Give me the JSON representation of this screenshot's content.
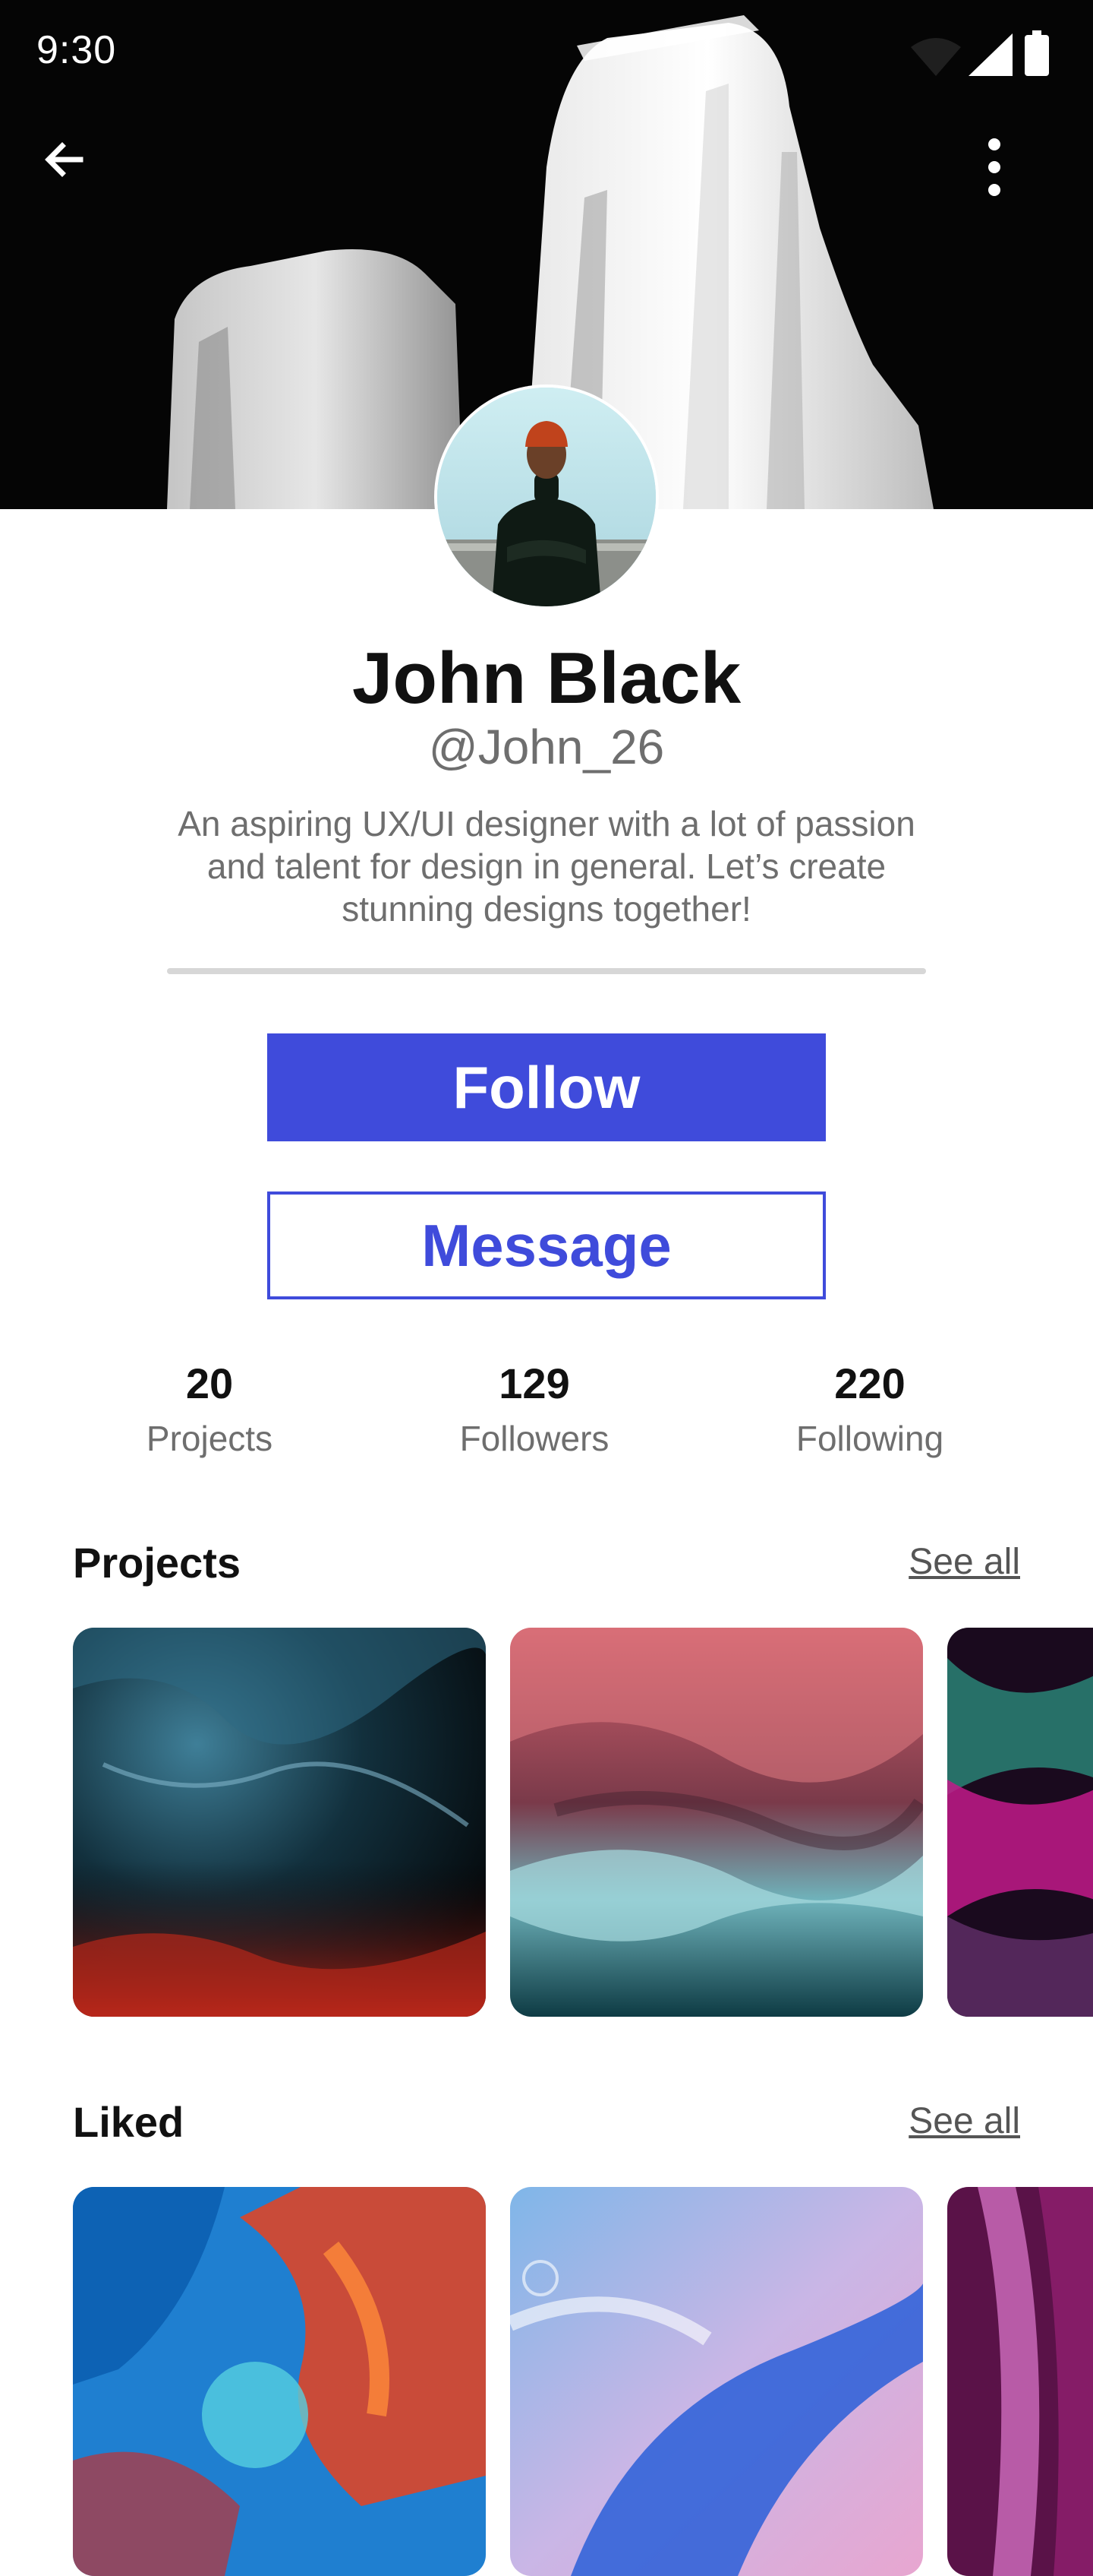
{
  "status_bar": {
    "time": "9:30"
  },
  "toolbar": {
    "back_icon": "arrow-left-icon",
    "more_icon": "more-vertical-icon"
  },
  "profile": {
    "name": "John Black",
    "handle": "@John_26",
    "bio": "An aspiring UX/UI designer with a lot of passion and talent for design in general. Let’s create stunning designs together!"
  },
  "actions": {
    "follow_label": "Follow",
    "message_label": "Message"
  },
  "stats": [
    {
      "value": "20",
      "label": "Projects"
    },
    {
      "value": "129",
      "label": "Followers"
    },
    {
      "value": "220",
      "label": "Following"
    }
  ],
  "sections": {
    "projects": {
      "title": "Projects",
      "see_all": "See all"
    },
    "liked": {
      "title": "Liked",
      "see_all": "See all"
    }
  },
  "colors": {
    "accent": "#3f4bdb",
    "muted_text": "#6e6e6e",
    "divider": "#d7d7d7"
  }
}
